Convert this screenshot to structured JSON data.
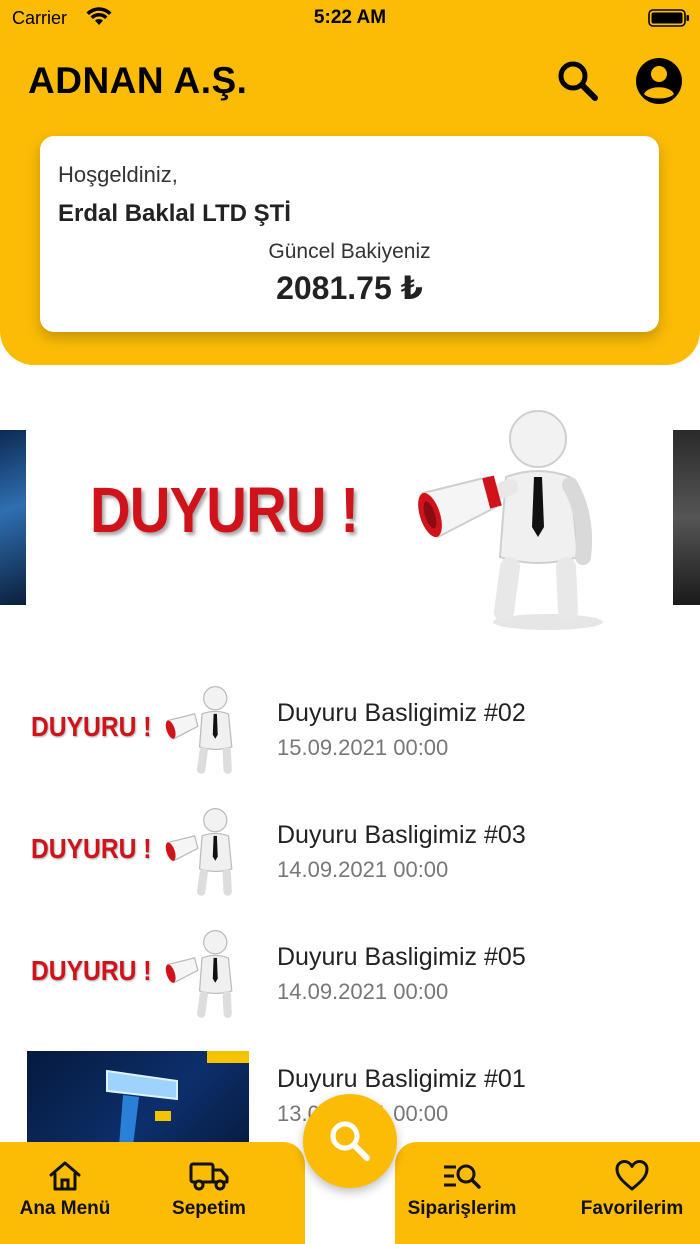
{
  "status_bar": {
    "carrier": "Carrier",
    "time": "5:22 AM"
  },
  "header": {
    "title": "ADNAN A.Ş.",
    "search_icon": "search-icon",
    "account_icon": "account-circle-icon"
  },
  "welcome_card": {
    "greeting": "Hoşgeldiniz,",
    "company": "Erdal Baklal LTD ŞTİ",
    "balance_label": "Güncel Bakiyeniz",
    "balance_value": "2081.75 ₺"
  },
  "carousel": {
    "main_slide_text": "DUYURU !"
  },
  "announcements": [
    {
      "thumb_text": "DUYURU !",
      "title": "Duyuru Basligimiz #02",
      "date": "15.09.2021 00:00"
    },
    {
      "thumb_text": "DUYURU !",
      "title": "Duyuru Basligimiz #03",
      "date": "14.09.2021 00:00"
    },
    {
      "thumb_text": "DUYURU !",
      "title": "Duyuru Basligimiz #05",
      "date": "14.09.2021 00:00"
    },
    {
      "thumb_text": "",
      "title": "Duyuru Basligimiz #01",
      "date": "13.09.2021 00:00"
    }
  ],
  "bottom_nav": {
    "items": [
      {
        "label": "Ana Menü",
        "icon": "home-icon"
      },
      {
        "label": "Sepetim",
        "icon": "truck-icon"
      },
      {
        "label": "Siparişlerim",
        "icon": "order-search-icon"
      },
      {
        "label": "Favorilerim",
        "icon": "heart-icon"
      }
    ],
    "fab_icon": "search-icon"
  },
  "colors": {
    "brand": "#FCBC05",
    "announcement_red": "#d0121b"
  }
}
